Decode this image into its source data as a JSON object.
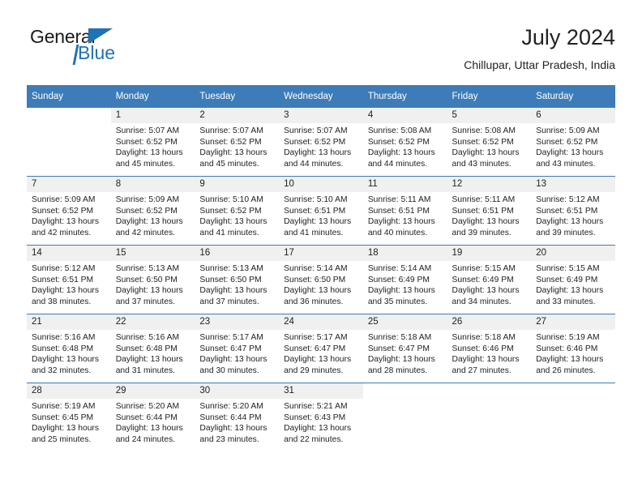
{
  "brand": {
    "word_one": "General",
    "word_two": "Blue"
  },
  "header": {
    "title": "July 2024",
    "subtitle": "Chillupar, Uttar Pradesh, India"
  },
  "weekday_headers": [
    "Sunday",
    "Monday",
    "Tuesday",
    "Wednesday",
    "Thursday",
    "Friday",
    "Saturday"
  ],
  "colors": {
    "header_blue": "#3d7cb8",
    "brand_blue": "#1f72b8",
    "daynum_band": "#f0f0f0",
    "text": "#222222"
  },
  "weeks": [
    [
      {
        "day": "",
        "sunrise": "",
        "sunset": "",
        "daylight_line1": "",
        "daylight_line2": "",
        "empty": true
      },
      {
        "day": "1",
        "sunrise": "Sunrise: 5:07 AM",
        "sunset": "Sunset: 6:52 PM",
        "daylight_line1": "Daylight: 13 hours",
        "daylight_line2": "and 45 minutes.",
        "empty": false
      },
      {
        "day": "2",
        "sunrise": "Sunrise: 5:07 AM",
        "sunset": "Sunset: 6:52 PM",
        "daylight_line1": "Daylight: 13 hours",
        "daylight_line2": "and 45 minutes.",
        "empty": false
      },
      {
        "day": "3",
        "sunrise": "Sunrise: 5:07 AM",
        "sunset": "Sunset: 6:52 PM",
        "daylight_line1": "Daylight: 13 hours",
        "daylight_line2": "and 44 minutes.",
        "empty": false
      },
      {
        "day": "4",
        "sunrise": "Sunrise: 5:08 AM",
        "sunset": "Sunset: 6:52 PM",
        "daylight_line1": "Daylight: 13 hours",
        "daylight_line2": "and 44 minutes.",
        "empty": false
      },
      {
        "day": "5",
        "sunrise": "Sunrise: 5:08 AM",
        "sunset": "Sunset: 6:52 PM",
        "daylight_line1": "Daylight: 13 hours",
        "daylight_line2": "and 43 minutes.",
        "empty": false
      },
      {
        "day": "6",
        "sunrise": "Sunrise: 5:09 AM",
        "sunset": "Sunset: 6:52 PM",
        "daylight_line1": "Daylight: 13 hours",
        "daylight_line2": "and 43 minutes.",
        "empty": false
      }
    ],
    [
      {
        "day": "7",
        "sunrise": "Sunrise: 5:09 AM",
        "sunset": "Sunset: 6:52 PM",
        "daylight_line1": "Daylight: 13 hours",
        "daylight_line2": "and 42 minutes.",
        "empty": false
      },
      {
        "day": "8",
        "sunrise": "Sunrise: 5:09 AM",
        "sunset": "Sunset: 6:52 PM",
        "daylight_line1": "Daylight: 13 hours",
        "daylight_line2": "and 42 minutes.",
        "empty": false
      },
      {
        "day": "9",
        "sunrise": "Sunrise: 5:10 AM",
        "sunset": "Sunset: 6:52 PM",
        "daylight_line1": "Daylight: 13 hours",
        "daylight_line2": "and 41 minutes.",
        "empty": false
      },
      {
        "day": "10",
        "sunrise": "Sunrise: 5:10 AM",
        "sunset": "Sunset: 6:51 PM",
        "daylight_line1": "Daylight: 13 hours",
        "daylight_line2": "and 41 minutes.",
        "empty": false
      },
      {
        "day": "11",
        "sunrise": "Sunrise: 5:11 AM",
        "sunset": "Sunset: 6:51 PM",
        "daylight_line1": "Daylight: 13 hours",
        "daylight_line2": "and 40 minutes.",
        "empty": false
      },
      {
        "day": "12",
        "sunrise": "Sunrise: 5:11 AM",
        "sunset": "Sunset: 6:51 PM",
        "daylight_line1": "Daylight: 13 hours",
        "daylight_line2": "and 39 minutes.",
        "empty": false
      },
      {
        "day": "13",
        "sunrise": "Sunrise: 5:12 AM",
        "sunset": "Sunset: 6:51 PM",
        "daylight_line1": "Daylight: 13 hours",
        "daylight_line2": "and 39 minutes.",
        "empty": false
      }
    ],
    [
      {
        "day": "14",
        "sunrise": "Sunrise: 5:12 AM",
        "sunset": "Sunset: 6:51 PM",
        "daylight_line1": "Daylight: 13 hours",
        "daylight_line2": "and 38 minutes.",
        "empty": false
      },
      {
        "day": "15",
        "sunrise": "Sunrise: 5:13 AM",
        "sunset": "Sunset: 6:50 PM",
        "daylight_line1": "Daylight: 13 hours",
        "daylight_line2": "and 37 minutes.",
        "empty": false
      },
      {
        "day": "16",
        "sunrise": "Sunrise: 5:13 AM",
        "sunset": "Sunset: 6:50 PM",
        "daylight_line1": "Daylight: 13 hours",
        "daylight_line2": "and 37 minutes.",
        "empty": false
      },
      {
        "day": "17",
        "sunrise": "Sunrise: 5:14 AM",
        "sunset": "Sunset: 6:50 PM",
        "daylight_line1": "Daylight: 13 hours",
        "daylight_line2": "and 36 minutes.",
        "empty": false
      },
      {
        "day": "18",
        "sunrise": "Sunrise: 5:14 AM",
        "sunset": "Sunset: 6:49 PM",
        "daylight_line1": "Daylight: 13 hours",
        "daylight_line2": "and 35 minutes.",
        "empty": false
      },
      {
        "day": "19",
        "sunrise": "Sunrise: 5:15 AM",
        "sunset": "Sunset: 6:49 PM",
        "daylight_line1": "Daylight: 13 hours",
        "daylight_line2": "and 34 minutes.",
        "empty": false
      },
      {
        "day": "20",
        "sunrise": "Sunrise: 5:15 AM",
        "sunset": "Sunset: 6:49 PM",
        "daylight_line1": "Daylight: 13 hours",
        "daylight_line2": "and 33 minutes.",
        "empty": false
      }
    ],
    [
      {
        "day": "21",
        "sunrise": "Sunrise: 5:16 AM",
        "sunset": "Sunset: 6:48 PM",
        "daylight_line1": "Daylight: 13 hours",
        "daylight_line2": "and 32 minutes.",
        "empty": false
      },
      {
        "day": "22",
        "sunrise": "Sunrise: 5:16 AM",
        "sunset": "Sunset: 6:48 PM",
        "daylight_line1": "Daylight: 13 hours",
        "daylight_line2": "and 31 minutes.",
        "empty": false
      },
      {
        "day": "23",
        "sunrise": "Sunrise: 5:17 AM",
        "sunset": "Sunset: 6:47 PM",
        "daylight_line1": "Daylight: 13 hours",
        "daylight_line2": "and 30 minutes.",
        "empty": false
      },
      {
        "day": "24",
        "sunrise": "Sunrise: 5:17 AM",
        "sunset": "Sunset: 6:47 PM",
        "daylight_line1": "Daylight: 13 hours",
        "daylight_line2": "and 29 minutes.",
        "empty": false
      },
      {
        "day": "25",
        "sunrise": "Sunrise: 5:18 AM",
        "sunset": "Sunset: 6:47 PM",
        "daylight_line1": "Daylight: 13 hours",
        "daylight_line2": "and 28 minutes.",
        "empty": false
      },
      {
        "day": "26",
        "sunrise": "Sunrise: 5:18 AM",
        "sunset": "Sunset: 6:46 PM",
        "daylight_line1": "Daylight: 13 hours",
        "daylight_line2": "and 27 minutes.",
        "empty": false
      },
      {
        "day": "27",
        "sunrise": "Sunrise: 5:19 AM",
        "sunset": "Sunset: 6:46 PM",
        "daylight_line1": "Daylight: 13 hours",
        "daylight_line2": "and 26 minutes.",
        "empty": false
      }
    ],
    [
      {
        "day": "28",
        "sunrise": "Sunrise: 5:19 AM",
        "sunset": "Sunset: 6:45 PM",
        "daylight_line1": "Daylight: 13 hours",
        "daylight_line2": "and 25 minutes.",
        "empty": false
      },
      {
        "day": "29",
        "sunrise": "Sunrise: 5:20 AM",
        "sunset": "Sunset: 6:44 PM",
        "daylight_line1": "Daylight: 13 hours",
        "daylight_line2": "and 24 minutes.",
        "empty": false
      },
      {
        "day": "30",
        "sunrise": "Sunrise: 5:20 AM",
        "sunset": "Sunset: 6:44 PM",
        "daylight_line1": "Daylight: 13 hours",
        "daylight_line2": "and 23 minutes.",
        "empty": false
      },
      {
        "day": "31",
        "sunrise": "Sunrise: 5:21 AM",
        "sunset": "Sunset: 6:43 PM",
        "daylight_line1": "Daylight: 13 hours",
        "daylight_line2": "and 22 minutes.",
        "empty": false
      },
      {
        "day": "",
        "sunrise": "",
        "sunset": "",
        "daylight_line1": "",
        "daylight_line2": "",
        "empty": true
      },
      {
        "day": "",
        "sunrise": "",
        "sunset": "",
        "daylight_line1": "",
        "daylight_line2": "",
        "empty": true
      },
      {
        "day": "",
        "sunrise": "",
        "sunset": "",
        "daylight_line1": "",
        "daylight_line2": "",
        "empty": true
      }
    ]
  ]
}
